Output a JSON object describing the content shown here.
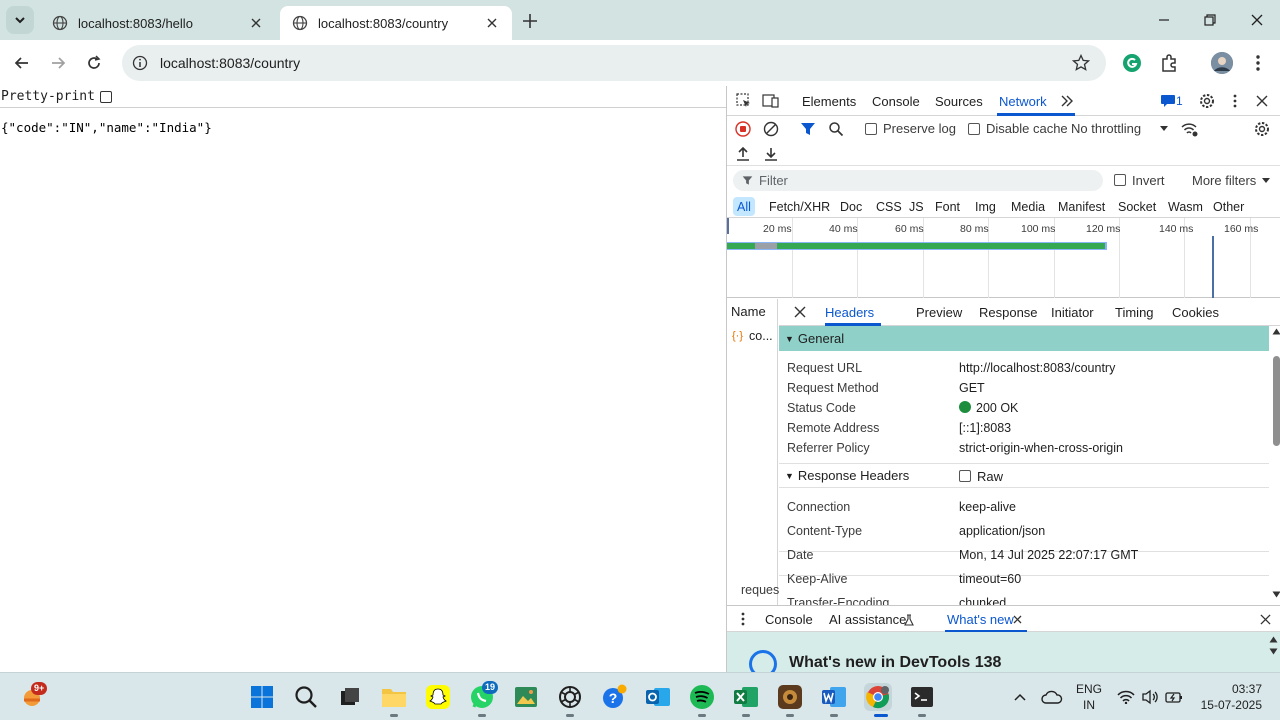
{
  "browser": {
    "tabs": [
      {
        "title": "localhost:8083/hello"
      },
      {
        "title": "localhost:8083/country"
      }
    ],
    "url": "localhost:8083/country"
  },
  "page": {
    "pretty_print_label": "Pretty-print",
    "json_text": "{\"code\":\"IN\",\"name\":\"India\"}"
  },
  "devtools": {
    "main_tabs": [
      "Elements",
      "Console",
      "Sources",
      "Network"
    ],
    "issues_count": "1",
    "toolbar": {
      "preserve_log": "Preserve log",
      "disable_cache": "Disable cache",
      "throttling": "No throttling"
    },
    "filter": {
      "placeholder": "Filter",
      "invert": "Invert",
      "more_filters": "More filters"
    },
    "type_filters": [
      "All",
      "Fetch/XHR",
      "Doc",
      "CSS",
      "JS",
      "Font",
      "Img",
      "Media",
      "Manifest",
      "Socket",
      "Wasm",
      "Other"
    ],
    "timeline_ticks": [
      "20 ms",
      "40 ms",
      "60 ms",
      "80 ms",
      "100 ms",
      "120 ms",
      "140 ms",
      "160 ms"
    ],
    "name_header": "Name",
    "request_name": "co...",
    "requests_footer": "reques",
    "detail_tabs": [
      "Headers",
      "Preview",
      "Response",
      "Initiator",
      "Timing",
      "Cookies"
    ],
    "general": {
      "title": "General",
      "rows": [
        {
          "key": "Request URL",
          "value": "http://localhost:8083/country"
        },
        {
          "key": "Request Method",
          "value": "GET"
        },
        {
          "key": "Status Code",
          "value": "200 OK"
        },
        {
          "key": "Remote Address",
          "value": "[::1]:8083"
        },
        {
          "key": "Referrer Policy",
          "value": "strict-origin-when-cross-origin"
        }
      ]
    },
    "response_headers": {
      "title": "Response Headers",
      "raw_label": "Raw",
      "rows": [
        {
          "key": "Connection",
          "value": "keep-alive"
        },
        {
          "key": "Content-Type",
          "value": "application/json"
        },
        {
          "key": "Date",
          "value": "Mon, 14 Jul 2025 22:07:17 GMT"
        },
        {
          "key": "Keep-Alive",
          "value": "timeout=60"
        },
        {
          "key": "Transfer-Encoding",
          "value": "chunked"
        }
      ]
    },
    "drawer_tabs": [
      "Console",
      "AI assistance",
      "What's new"
    ],
    "whats_new_heading": "What's new in DevTools 138"
  },
  "taskbar": {
    "weather_badge": "9+",
    "whatsapp_badge": "19",
    "lang": "ENG",
    "region": "IN",
    "time": "03:37",
    "date": "15-07-2025"
  },
  "colors": {
    "accent": "#0b57d0",
    "general_section_bg": "#8fd0c8",
    "status_ok": "#1e8e3e",
    "tabstrip_bg": "#d3e3e1"
  }
}
